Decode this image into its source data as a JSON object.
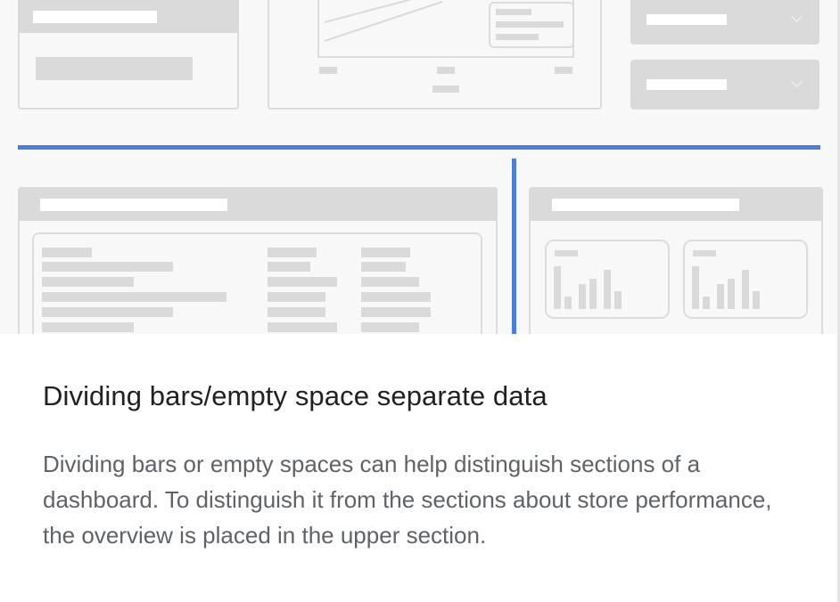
{
  "illustration": {
    "icons": [
      "chevron-down-icon",
      "chevron-down-icon",
      "bar-chart-icon",
      "bar-chart-icon"
    ],
    "colors": {
      "divider_accent": "#4a7fe0",
      "wireframe_gray": "#dadada",
      "background": "#f8f8f8"
    }
  },
  "caption": {
    "title": "Dividing bars/empty space separate data",
    "body": "Dividing bars or empty spaces can help distinguish sections of a dashboard. To distinguish it from the sections about store performance, the overview is placed in the upper section."
  }
}
